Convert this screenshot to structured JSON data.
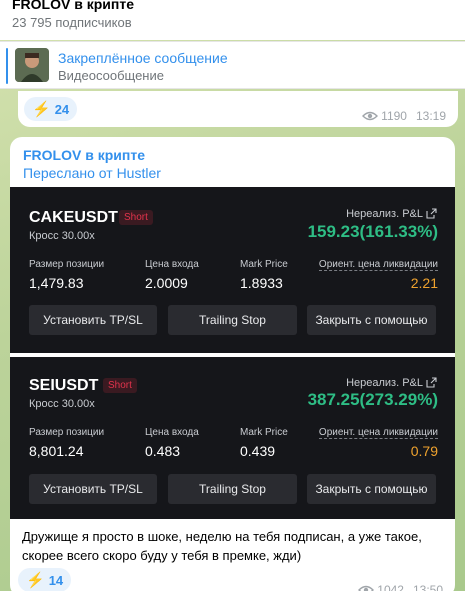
{
  "channel": {
    "title": "FROLOV в крипте",
    "subscribers": "23 795 подписчиков"
  },
  "pinned": {
    "title": "Закреплённое сообщение",
    "subtitle": "Видеосообщение"
  },
  "prev_message": {
    "reaction_count": "24",
    "views": "1190",
    "time": "13:19"
  },
  "message": {
    "author": "FROLOV в крипте",
    "forwarded_from": "Переслано от Hustler",
    "text": "Дружище я просто в шоке, неделю на тебя подписан, а уже такое, скорее всего скоро буду у тебя в премке, жди)",
    "reaction_count": "14",
    "views": "1042",
    "time": "13:50",
    "positions": [
      {
        "symbol": "CAKEUSDT",
        "side": "Short",
        "margin": "Кросс 30.00x",
        "pnl_label": "Нереализ. P&L",
        "pnl_value": "159.23(161.33%)",
        "size_label": "Размер позиции",
        "size": "1,479.83",
        "entry_label": "Цена входа",
        "entry": "2.0009",
        "mark_label": "Mark Price",
        "mark": "1.8933",
        "liq_label": "Ориент. цена ликвидации",
        "liq": "2.21",
        "buttons": [
          "Установить TP/SL",
          "Trailing Stop",
          "Закрыть с помощью"
        ]
      },
      {
        "symbol": "SEIUSDT",
        "side": "Short",
        "margin": "Кросс 30.00x",
        "pnl_label": "Нереализ. P&L",
        "pnl_value": "387.25(273.29%)",
        "size_label": "Размер позиции",
        "size": "8,801.24",
        "entry_label": "Цена входа",
        "entry": "0.483",
        "mark_label": "Mark Price",
        "mark": "0.439",
        "liq_label": "Ориент. цена ликвидации",
        "liq": "0.79",
        "buttons": [
          "Установить TP/SL",
          "Trailing Stop",
          "Закрыть с помощью"
        ]
      }
    ]
  }
}
